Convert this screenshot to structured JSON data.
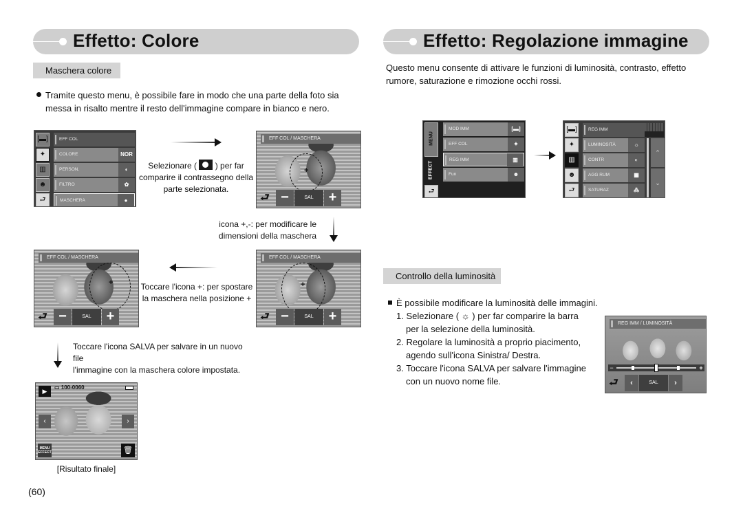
{
  "left_section": {
    "title": "Effetto: Colore",
    "subsection": "Maschera colore",
    "intro_line1": "Tramite questo menu, è possibile fare in modo che una parte della foto sia",
    "intro_line2": "messa in risalto mentre il resto dell'immagine compare in bianco e nero.",
    "menu_screen": {
      "header": "EFF COL",
      "rows": [
        {
          "label": "COLORE",
          "icon": "NOR"
        },
        {
          "label": "PERSON.",
          "icon": "custom-color-icon"
        },
        {
          "label": "FILTRO",
          "icon": "palette-icon"
        },
        {
          "label": "MASCHERA",
          "icon": "mask-icon"
        }
      ]
    },
    "step1_pre": "Selezionare (",
    "step1_post": ") per far",
    "step1_line2": "comparire il contrassegno della",
    "step1_line3": "parte selezionata.",
    "screen_title": "EFF COL / MASCHERA",
    "sal_label": "SAL",
    "step2_line1": "icona +,-: per modificare le",
    "step2_line2": "dimensioni della maschera",
    "step3_line1": "Toccare l'icona +: per spostare",
    "step3_line2": "la maschera nella posizione +",
    "step4_line1": "Toccare l'icona SALVA per salvare in un nuovo file",
    "step4_line2": "l'immagine con la maschera colore impostata.",
    "result_screen": {
      "file_number": "100-0060",
      "menu_label": "MENU",
      "effect_label": "EFFECT"
    },
    "result_caption": "[Risultato finale]"
  },
  "right_section": {
    "title": "Effetto: Regolazione immagine",
    "intro_line1": "Questo menu consente di attivare le funzioni di luminosità, contrasto, effetto",
    "intro_line2": "rumore, saturazione e rimozione occhi rossi.",
    "main_menu": {
      "side_top": "MENU",
      "side_bottom": "EFFECT",
      "rows": [
        "MOD IMM",
        "EFF COL",
        "REG IMM",
        "Fun"
      ],
      "selected": "REG IMM"
    },
    "reg_menu": {
      "header": "REG IMM",
      "rows": [
        "LUMINOSITÀ",
        "CONTR",
        "AGG RUM",
        "SATURAZ"
      ]
    },
    "subsection": "Controllo della luminosità",
    "bullet": "È possibile modificare la luminosità delle immagini.",
    "steps": [
      {
        "num": "1.",
        "line1_pre": "Selezionare (",
        "line1_post": ") per far comparire la barra",
        "line2": "per la selezione della luminosità."
      },
      {
        "num": "2.",
        "line1": "Regolare la luminosità a proprio piacimento,",
        "line2": "agendo sull'icona Sinistra/ Destra."
      },
      {
        "num": "3.",
        "line1": "Toccare l'icona SALVA per salvare l'immagine",
        "line2": "con un nuovo nome file."
      }
    ],
    "lum_screen": {
      "title": "REG IMM / LUMINOSITÀ",
      "sal_label": "SAL",
      "slider_level": 0.5
    }
  },
  "page_number": "(60)"
}
